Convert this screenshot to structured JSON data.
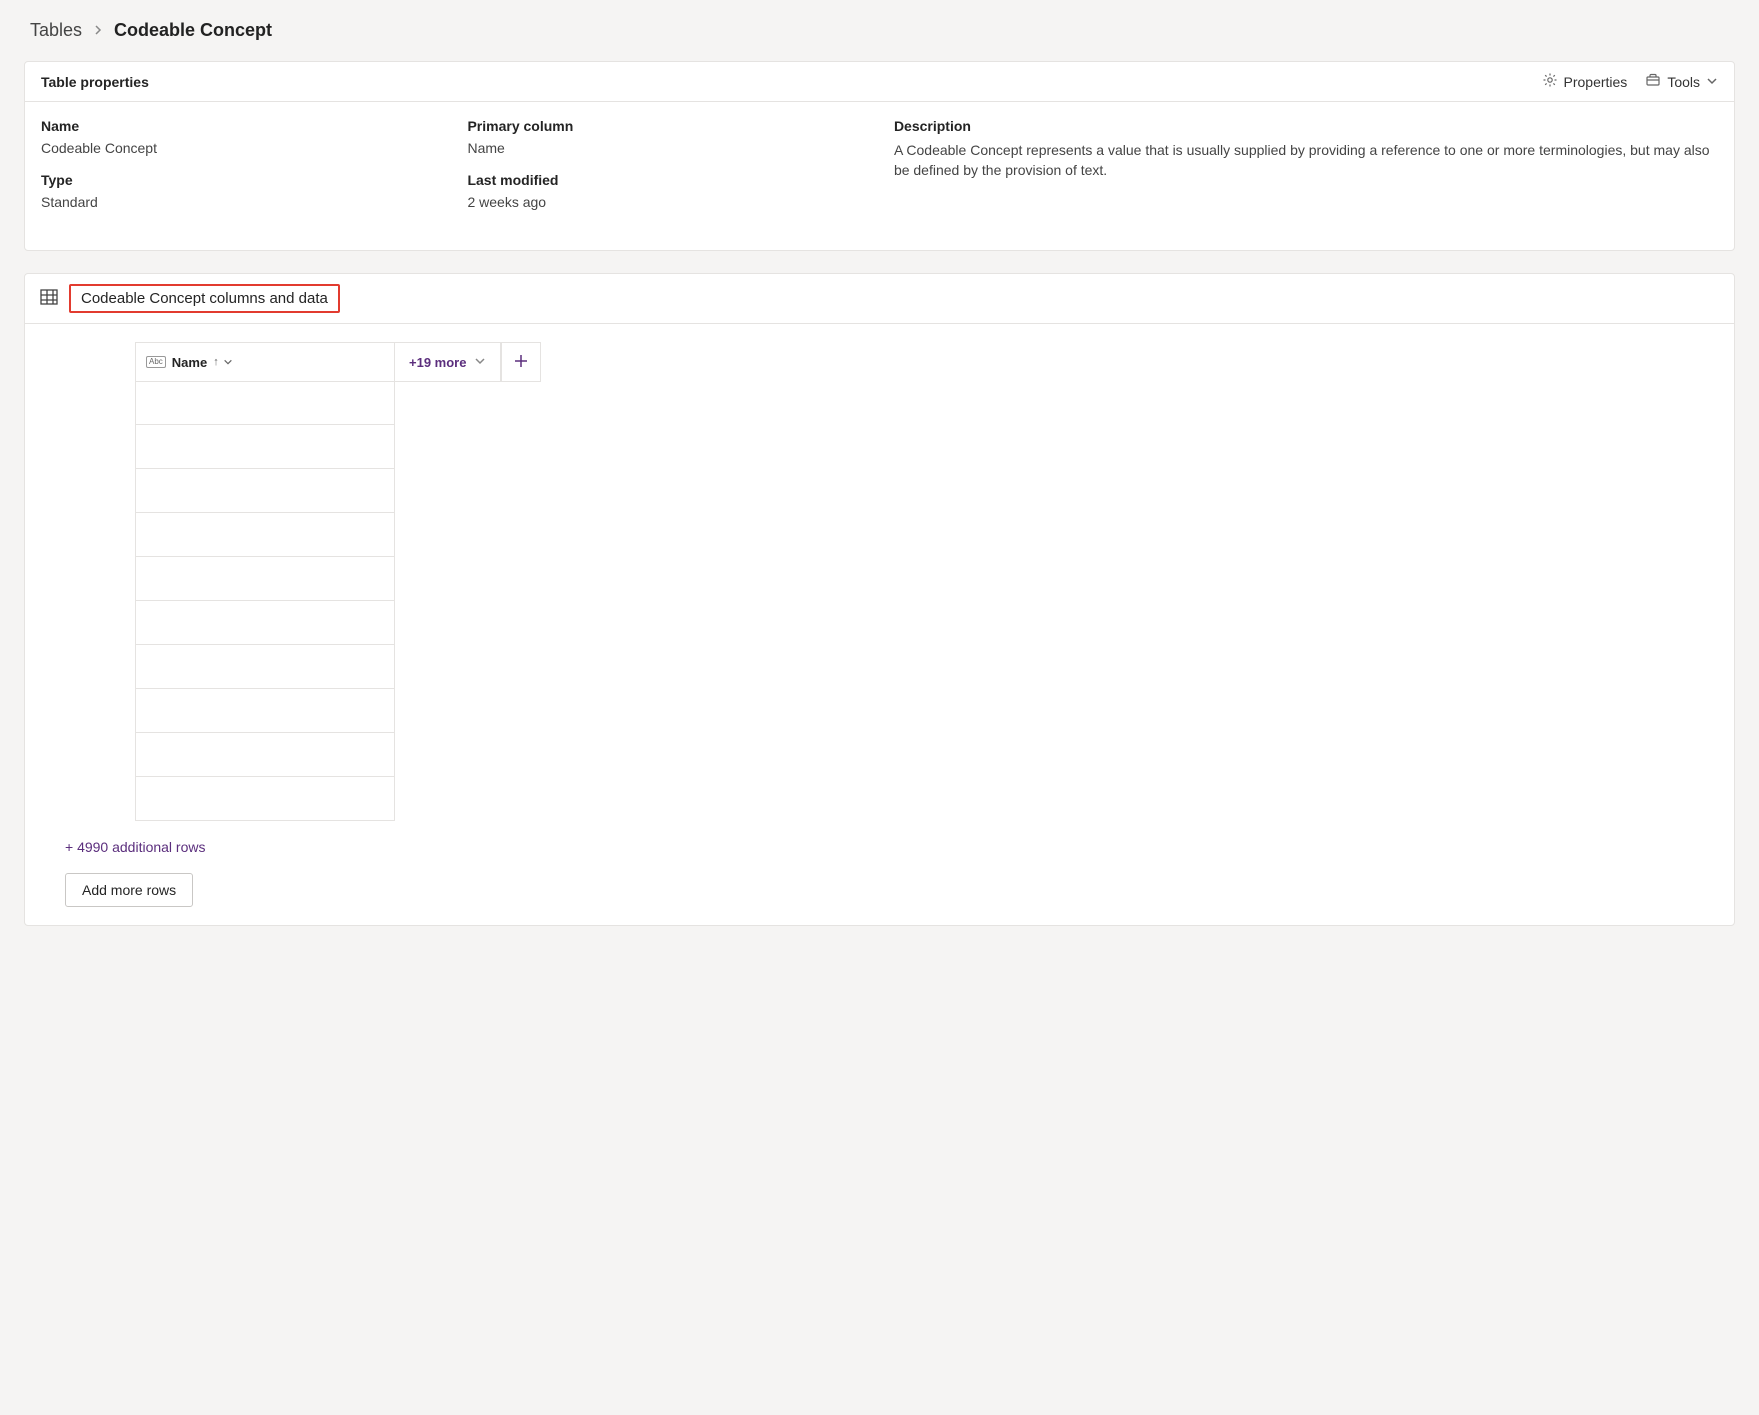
{
  "breadcrumb": {
    "root": "Tables",
    "current": "Codeable Concept"
  },
  "properties_panel": {
    "title": "Table properties",
    "actions": {
      "properties_label": "Properties",
      "tools_label": "Tools"
    },
    "fields": {
      "name_label": "Name",
      "name_value": "Codeable Concept",
      "type_label": "Type",
      "type_value": "Standard",
      "primary_column_label": "Primary column",
      "primary_column_value": "Name",
      "last_modified_label": "Last modified",
      "last_modified_value": "2 weeks ago",
      "description_label": "Description",
      "description_value": "A Codeable Concept represents a value that is usually supplied by providing a reference to one or more terminologies, but may also be defined by the provision of text."
    }
  },
  "columns_panel": {
    "title": "Codeable Concept columns and data",
    "header_column": {
      "label": "Name"
    },
    "more_columns_label": "+19 more",
    "visible_row_count": 10,
    "additional_rows_label": "+ 4990 additional rows",
    "add_more_rows_label": "Add more rows"
  }
}
